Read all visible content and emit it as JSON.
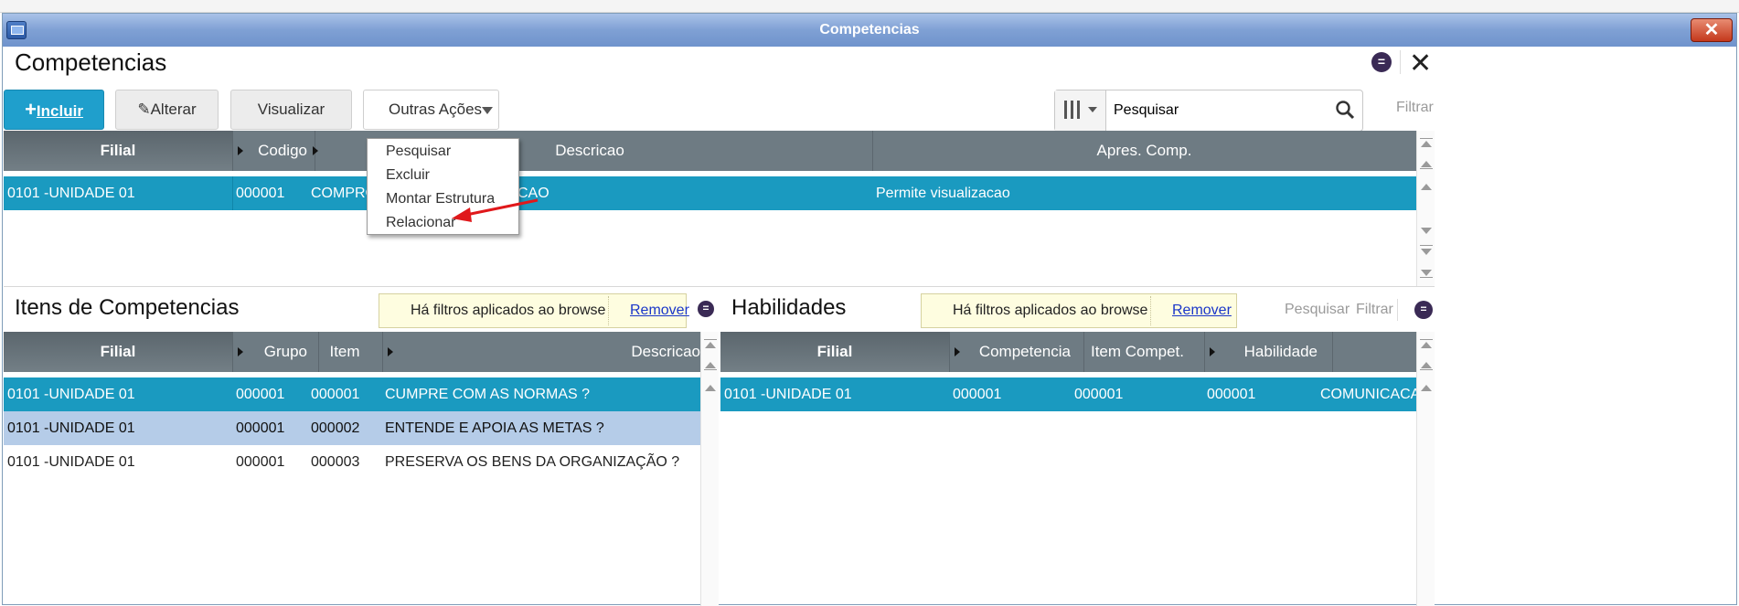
{
  "window": {
    "title": "Competencias",
    "close_glyph": "✕"
  },
  "header": {
    "title": "Competencias",
    "close_glyph": "✕",
    "menu_glyph": "="
  },
  "toolbar": {
    "incluir": "Incluir",
    "incluir_plus": "+",
    "alterar": "Alterar",
    "visualizar": "Visualizar",
    "outras": "Outras Ações"
  },
  "search": {
    "value": "Pesquisar",
    "filter_label": "Filtrar"
  },
  "menu": {
    "items": [
      "Pesquisar",
      "Excluir",
      "Montar Estrutura",
      "Relacionar"
    ]
  },
  "main_grid": {
    "columns": [
      "Filial",
      "Codigo",
      "Descricao",
      "Apres. Comp."
    ],
    "rows": [
      {
        "filial": "0101  -UNIDADE 01",
        "codigo": "000001",
        "descricao_left": "COMPRO",
        "descricao_right": "CAO",
        "apres": "Permite visualizacao"
      }
    ]
  },
  "itens": {
    "title": "Itens de Competencias",
    "filter_text": "Há filtros aplicados ao browse",
    "remove_link": "Remover",
    "columns": [
      "Filial",
      "Grupo",
      "Item",
      "Descricao"
    ],
    "rows": [
      {
        "filial": "0101  -UNIDADE 01",
        "grupo": "000001",
        "item": "000001",
        "descricao": "CUMPRE COM AS NORMAS ?"
      },
      {
        "filial": "0101  -UNIDADE 01",
        "grupo": "000001",
        "item": "000002",
        "descricao": "ENTENDE E APOIA AS METAS ?"
      },
      {
        "filial": "0101  -UNIDADE 01",
        "grupo": "000001",
        "item": "000003",
        "descricao": "PRESERVA OS BENS DA ORGANIZAÇÃO ?"
      }
    ]
  },
  "habilidades": {
    "title": "Habilidades",
    "filter_text": "Há filtros aplicados ao browse",
    "remove_link": "Remover",
    "search_label": "Pesquisar",
    "filter_label": "Filtrar",
    "columns": [
      "Filial",
      "Competencia",
      "Item Compet.",
      "Habilidade"
    ],
    "rows": [
      {
        "filial": "0101  -UNIDADE 01",
        "competencia": "000001",
        "item": "000001",
        "habilidade": "000001",
        "extra": "COMUNICACAO"
      }
    ]
  },
  "colors": {
    "selected_row": "#1a9ac0",
    "alt_row": "#b5cce8",
    "header": "#6e7b83",
    "primary": "#1f9fcc",
    "annotation_arrow": "#e0181b"
  }
}
